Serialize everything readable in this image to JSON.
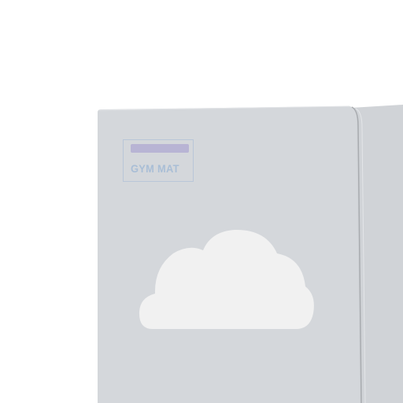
{
  "product": {
    "tag_text": "",
    "title": "GYM MAT"
  },
  "colors": {
    "background": "#ffffff",
    "mat_front": "#d4d7db",
    "mat_side": "#d0d3d7",
    "fold_line": "#a8abaf",
    "cloud": "#f1f1f1",
    "label_border": "#b9c6d8",
    "label_tag": "#b8b4d4",
    "label_title": "#a9bed6"
  },
  "icons": {
    "cloud": "cloud-icon"
  }
}
